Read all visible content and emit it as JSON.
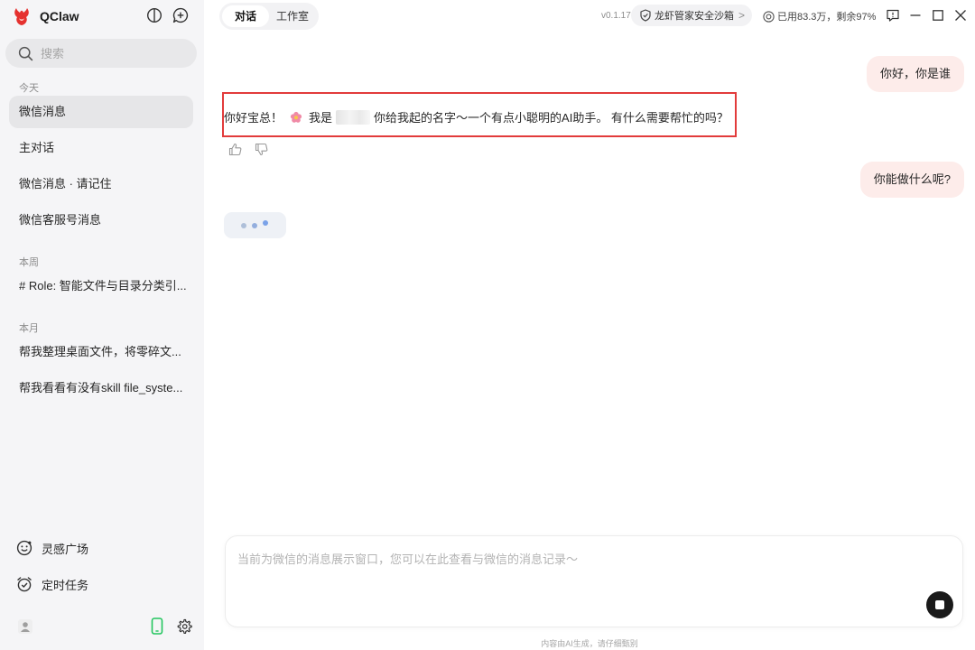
{
  "app": {
    "name": "QClaw"
  },
  "sidebar": {
    "search_placeholder": "搜索",
    "groups": [
      {
        "label": "今天",
        "items": [
          "微信消息",
          "主对话",
          "微信消息 · 请记住",
          "微信客服号消息"
        ]
      },
      {
        "label": "本周",
        "items": [
          "# Role: 智能文件与目录分类引..."
        ]
      },
      {
        "label": "本月",
        "items": [
          "帮我整理桌面文件，将零碎文...",
          "帮我看看有没有skill file_syste..."
        ]
      }
    ],
    "bottom": {
      "inspiration": "灵感广场",
      "scheduled": "定时任务"
    }
  },
  "header": {
    "tabs": [
      "对话",
      "工作室"
    ],
    "version": "v0.1.17",
    "sandbox": "龙虾管家安全沙箱",
    "usage": "已用83.3万，剩余97%"
  },
  "chat": {
    "user_msg_1": "你好，你是谁",
    "ai_msg_part1": "你好宝总！",
    "ai_msg_part2": "我是",
    "ai_msg_part3": "你给我起的名字～一个有点小聪明的AI助手。 有什么需要帮忙的吗？",
    "user_msg_2": "你能做什么呢?"
  },
  "composer": {
    "placeholder": "当前为微信的消息展示窗口，您可以在此查看与微信的消息记录～",
    "disclaimer": "内容由AI生成，请仔细甄别"
  },
  "colors": {
    "accent_red": "#e23b3b",
    "user_bubble": "#fdecea",
    "phone_icon": "#22c55e",
    "typing_dot": "#7aa2e8"
  },
  "icons": [
    "qclaw-logo-icon",
    "sidebar-toggle-icon",
    "new-chat-icon",
    "search-icon",
    "inspiration-icon",
    "alarm-clock-icon",
    "user-avatar-icon",
    "phone-icon",
    "gear-icon",
    "shield-icon",
    "token-icon",
    "feedback-icon",
    "minimize-icon",
    "maximize-icon",
    "close-icon",
    "flower-icon",
    "thumbs-up-icon",
    "thumbs-down-icon",
    "stop-icon"
  ]
}
